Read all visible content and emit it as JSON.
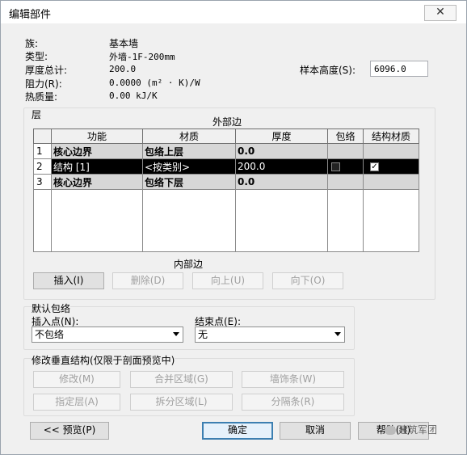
{
  "window": {
    "title": "编辑部件",
    "close_glyph": "✕"
  },
  "info": {
    "family_label": "族:",
    "family_value": "基本墙",
    "type_label": "类型:",
    "type_value": "外墙-1F-200mm",
    "thickness_label": "厚度总计:",
    "thickness_value": "200.0",
    "resistance_label": "阻力(R):",
    "resistance_value": "0.0000 (m² · K)/W",
    "thermal_label": "热质量:",
    "thermal_value": "0.00 kJ/K",
    "sample_height_label": "样本高度(S):",
    "sample_height_value": "6096.0"
  },
  "layers": {
    "group_label": "层",
    "exterior_label": "外部边",
    "interior_label": "内部边",
    "headers": [
      "",
      "功能",
      "材质",
      "厚度",
      "包络",
      "结构材质"
    ],
    "rows": [
      {
        "num": "1",
        "function": "核心边界",
        "material": "包络上层",
        "thickness": "0.0"
      },
      {
        "num": "2",
        "function": "结构 [1]",
        "material": "<按类别>",
        "thickness": "200.0"
      },
      {
        "num": "3",
        "function": "核心边界",
        "material": "包络下层",
        "thickness": "0.0"
      }
    ],
    "buttons": {
      "insert": "插入(I)",
      "delete": "删除(D)",
      "up": "向上(U)",
      "down": "向下(O)"
    }
  },
  "wrapping": {
    "group_label": "默认包络",
    "insert_label": "插入点(N):",
    "insert_value": "不包络",
    "end_label": "结束点(E):",
    "end_value": "无"
  },
  "vertical": {
    "group_label": "修改垂直结构(仅限于剖面预览中)",
    "modify": "修改(M)",
    "merge": "合并区域(G)",
    "sweep": "墙饰条(W)",
    "assign": "指定层(A)",
    "split": "拆分区域(L)",
    "reveal": "分隔条(R)"
  },
  "footer": {
    "preview": "<< 预览(P)",
    "ok": "确定",
    "cancel": "取消",
    "help": "帮助(H)"
  },
  "watermark": "建筑军团"
}
